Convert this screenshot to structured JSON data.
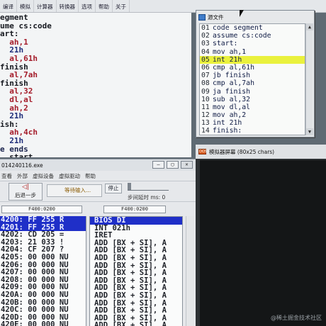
{
  "toolbar": {
    "items": [
      "编译",
      "模拟",
      "计算器",
      "转换器",
      "选项",
      "帮助",
      "关于"
    ]
  },
  "editor": {
    "lines": [
      {
        "text": "egment",
        "color": "c-black"
      },
      {
        "text": "ume cs:code",
        "color": "c-black"
      },
      {
        "text": "art:",
        "color": "c-black"
      },
      {
        "text": "  ah,1",
        "color": "c-red"
      },
      {
        "text": "  21h",
        "color": "c-navy"
      },
      {
        "text": "  al,61h",
        "color": "c-red"
      },
      {
        "text": "finish",
        "color": "c-black"
      },
      {
        "text": "  al,7ah",
        "color": "c-red"
      },
      {
        "text": "finish",
        "color": "c-black"
      },
      {
        "text": "  al,32",
        "color": "c-red"
      },
      {
        "text": "  dl,al",
        "color": "c-red"
      },
      {
        "text": "  ah,2",
        "color": "c-red"
      },
      {
        "text": "  21h",
        "color": "c-navy"
      },
      {
        "text": "ish:",
        "color": "c-black"
      },
      {
        "text": "  ah,4ch",
        "color": "c-red"
      },
      {
        "text": "  21h",
        "color": "c-navy"
      },
      {
        "text": "e ends",
        "color": "c-dkblue"
      },
      {
        "text": "  start",
        "color": "c-black"
      }
    ]
  },
  "source_window": {
    "title": "源文件",
    "lines": [
      {
        "num": "01",
        "code": "code segment"
      },
      {
        "num": "02",
        "code": "assume cs:code"
      },
      {
        "num": "03",
        "code": "start:"
      },
      {
        "num": "04",
        "code": "mov ah,1"
      },
      {
        "num": "05",
        "code": "int 21h"
      },
      {
        "num": "06",
        "code": "cmp al,61h"
      },
      {
        "num": "07",
        "code": "jb finish"
      },
      {
        "num": "08",
        "code": "cmp al,7ah"
      },
      {
        "num": "09",
        "code": "ja finish"
      },
      {
        "num": "10",
        "code": "sub al,32"
      },
      {
        "num": "11",
        "code": "mov dl,al"
      },
      {
        "num": "12",
        "code": "mov ah,2"
      },
      {
        "num": "13",
        "code": "int 21h"
      },
      {
        "num": "14",
        "code": "finish:"
      }
    ],
    "highlight_index": 4
  },
  "debugger": {
    "title": "014240116.exe",
    "menu": [
      "查看",
      "外部",
      "虚拟设备",
      "虚拟驱动",
      "帮助"
    ],
    "back_label": "后退一步",
    "wait_label": "等待输入...",
    "stop_label": "停止",
    "step_delay": "步间延时 ms: 0",
    "addr_left": "F400:0200",
    "addr_right": "F400:0200",
    "memory": [
      {
        "text": "4200: FF 255 R",
        "sel": true
      },
      {
        "text": "4201: FF 255 R",
        "sel": true
      },
      {
        "text": "4202: CD 205 =",
        "sel": false
      },
      {
        "text": "4203: 21 033 !",
        "sel": false
      },
      {
        "text": "4204: CF 207 ?",
        "sel": false
      },
      {
        "text": "4205: 00 000 NU",
        "sel": false
      },
      {
        "text": "4206: 00 000 NU",
        "sel": false
      },
      {
        "text": "4207: 00 000 NU",
        "sel": false
      },
      {
        "text": "4208: 00 000 NU",
        "sel": false
      },
      {
        "text": "4209: 00 000 NU",
        "sel": false
      },
      {
        "text": "420A: 00 000 NU",
        "sel": false
      },
      {
        "text": "420B: 00 000 NU",
        "sel": false
      },
      {
        "text": "420C: 00 000 NU",
        "sel": false
      },
      {
        "text": "420D: 00 000 NU",
        "sel": false
      },
      {
        "text": "420E: 00 000 NU",
        "sel": false
      }
    ],
    "disasm": [
      {
        "text": "BIOS DI",
        "sel": true
      },
      {
        "text": "INT 021h",
        "sel": false
      },
      {
        "text": "IRET",
        "sel": false
      },
      {
        "text": "ADD [BX + SI], A",
        "sel": false
      },
      {
        "text": "ADD [BX + SI], A",
        "sel": false
      },
      {
        "text": "ADD [BX + SI], A",
        "sel": false
      },
      {
        "text": "ADD [BX + SI], A",
        "sel": false
      },
      {
        "text": "ADD [BX + SI], A",
        "sel": false
      },
      {
        "text": "ADD [BX + SI], A",
        "sel": false
      },
      {
        "text": "ADD [BX + SI], A",
        "sel": false
      },
      {
        "text": "ADD [BX + SI], A",
        "sel": false
      },
      {
        "text": "ADD [BX + SI], A",
        "sel": false
      },
      {
        "text": "ADD [BX + SI], A",
        "sel": false
      },
      {
        "text": "ADD [BX + SI], A",
        "sel": false
      },
      {
        "text": "ADD [BX + SI], A",
        "sel": false
      }
    ]
  },
  "emulator": {
    "title": "模拟器屏幕 (80x25 chars)",
    "icon_text": "DOS"
  },
  "watermark": "@稀土掘金技术社区",
  "colors": {
    "highlight": "#eaf13d",
    "selection": "#1f2fc8"
  }
}
